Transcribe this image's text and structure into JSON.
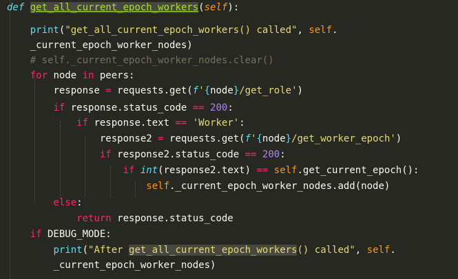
{
  "colors": {
    "background": "#272822",
    "default": "#f8f8f2",
    "keyword": "#f92672",
    "function": "#a6e22e",
    "builtin": "#66d9ef",
    "string": "#e6db74",
    "number": "#ae81ff",
    "comment": "#75715e",
    "self": "#fd971f"
  },
  "code": {
    "l1": {
      "def_kw": "def",
      "fn_name": "get_all_current_epoch_workers",
      "open": "(",
      "param": "self",
      "close": "):"
    },
    "l2": {
      "print": "print",
      "open": "(",
      "str": "\"get_all_current_epoch_workers() called\"",
      "comma": ", ",
      "self": "self",
      "dot": "."
    },
    "l3": {
      "attr": "_current_epoch_worker_nodes",
      "close": ")"
    },
    "l4": {
      "comment": "# self._current_epoch_worker_nodes.clear()"
    },
    "l5": {
      "for_kw": "for",
      "text1": " node ",
      "in_kw": "in",
      "text2": " peers:"
    },
    "l6": {
      "text1": "response ",
      "eq": "=",
      "text2": " requests.get(",
      "f_prefix": "f",
      "str1": "'",
      "brace_open": "{",
      "node": "node",
      "brace_close": "}",
      "str2": "/get_role'",
      "close": ")"
    },
    "l7": {
      "if_kw": "if",
      "text1": " response.status_code ",
      "op": "==",
      "space": " ",
      "num": "200",
      "colon": ":"
    },
    "l8": {
      "if_kw": "if",
      "text1": " response.text ",
      "op": "==",
      "space": " ",
      "str": "'Worker'",
      "colon": ":"
    },
    "l9": {
      "text1": "response2 ",
      "eq": "=",
      "text2": " requests.get(",
      "f_prefix": "f",
      "str1": "'",
      "brace_open": "{",
      "node": "node",
      "brace_close": "}",
      "str2": "/get_worker_epoch'",
      "close": ")"
    },
    "l10": {
      "if_kw": "if",
      "text1": " response2.status_code ",
      "op": "==",
      "space": " ",
      "num": "200",
      "colon": ":"
    },
    "l11": {
      "if_kw": "if",
      "space1": " ",
      "int_kw": "int",
      "text1": "(response2.text) ",
      "op": "==",
      "space2": " ",
      "self": "self",
      "text2": ".get_current_epoch():"
    },
    "l12": {
      "self": "self",
      "text1": "._current_epoch_worker_nodes.add(node)"
    },
    "l13": {
      "else_kw": "else",
      "colon": ":"
    },
    "l14": {
      "return_kw": "return",
      "text1": " response.status_code"
    },
    "l15": {
      "if_kw": "if",
      "text1": " DEBUG_MODE:"
    },
    "l16": {
      "print": "print",
      "open": "(",
      "str_pre": "\"After ",
      "str_hl": "get_all_current_epoch_workers",
      "str_post": "() called\"",
      "comma": ", ",
      "self": "self",
      "dot": "."
    },
    "l17": {
      "attr": "_current_epoch_worker_nodes",
      "close": ")"
    }
  }
}
